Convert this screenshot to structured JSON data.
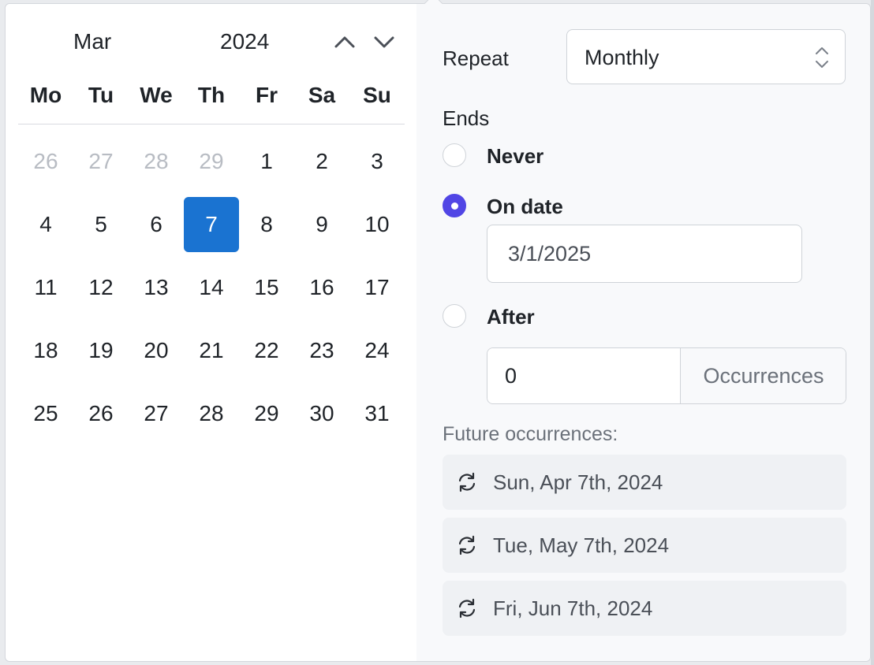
{
  "calendar": {
    "month": "Mar",
    "year": "2024",
    "weekdays": [
      "Mo",
      "Tu",
      "We",
      "Th",
      "Fr",
      "Sa",
      "Su"
    ],
    "days": [
      {
        "label": "26",
        "muted": true
      },
      {
        "label": "27",
        "muted": true
      },
      {
        "label": "28",
        "muted": true
      },
      {
        "label": "29",
        "muted": true
      },
      {
        "label": "1"
      },
      {
        "label": "2"
      },
      {
        "label": "3"
      },
      {
        "label": "4"
      },
      {
        "label": "5"
      },
      {
        "label": "6"
      },
      {
        "label": "7",
        "selected": true
      },
      {
        "label": "8"
      },
      {
        "label": "9"
      },
      {
        "label": "10"
      },
      {
        "label": "11"
      },
      {
        "label": "12"
      },
      {
        "label": "13"
      },
      {
        "label": "14"
      },
      {
        "label": "15"
      },
      {
        "label": "16"
      },
      {
        "label": "17"
      },
      {
        "label": "18"
      },
      {
        "label": "19"
      },
      {
        "label": "20"
      },
      {
        "label": "21"
      },
      {
        "label": "22"
      },
      {
        "label": "23"
      },
      {
        "label": "24"
      },
      {
        "label": "25"
      },
      {
        "label": "26"
      },
      {
        "label": "27"
      },
      {
        "label": "28"
      },
      {
        "label": "29"
      },
      {
        "label": "30"
      },
      {
        "label": "31"
      }
    ],
    "selected_color": "#1a73d1"
  },
  "recurrence": {
    "repeat_label": "Repeat",
    "repeat_value": "Monthly",
    "ends_label": "Ends",
    "options": {
      "never": "Never",
      "on_date": "On date",
      "after": "After"
    },
    "selected_option": "on_date",
    "end_date_value": "3/1/2025",
    "occurrences_value": "0",
    "occurrences_addon": "Occurrences",
    "accent_color": "#5146e5"
  },
  "future": {
    "label": "Future occurrences:",
    "icon": "repeat-icon",
    "items": [
      "Sun, Apr 7th, 2024",
      "Tue, May 7th, 2024",
      "Fri, Jun 7th, 2024"
    ]
  }
}
